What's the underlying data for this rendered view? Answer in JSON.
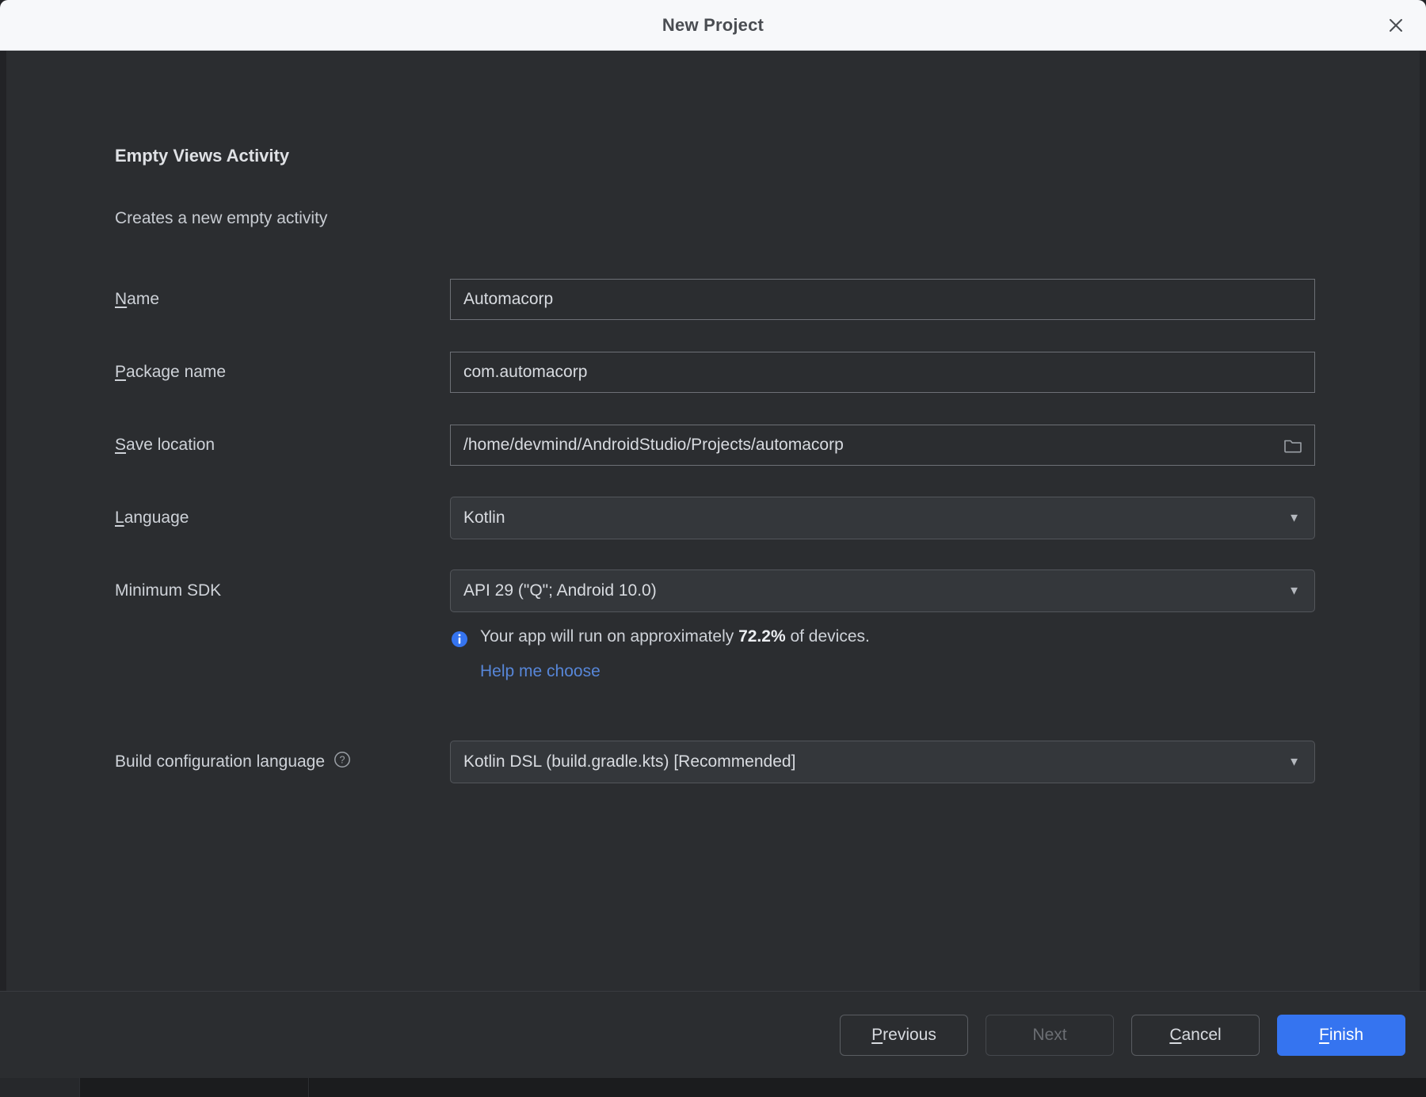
{
  "window": {
    "title": "New Project",
    "close_icon": "close-icon"
  },
  "step": {
    "title": "Empty Views Activity",
    "subtitle": "Creates a new empty activity"
  },
  "form": {
    "name": {
      "label_mnemonic": "N",
      "label_rest": "ame",
      "value": "Automacorp"
    },
    "package_name": {
      "label_mnemonic": "P",
      "label_rest": "ackage name",
      "value": "com.automacorp"
    },
    "save_location": {
      "label_mnemonic": "S",
      "label_rest": "ave location",
      "value": "/home/devmind/AndroidStudio/Projects/automacorp",
      "browse_icon": "folder-icon"
    },
    "language": {
      "label_mnemonic": "L",
      "label_rest": "anguage",
      "value": "Kotlin",
      "arrow": "▼"
    },
    "minimum_sdk": {
      "label": "Minimum SDK",
      "value": "API 29 (\"Q\"; Android 10.0)",
      "arrow": "▼"
    },
    "sdk_info": {
      "icon": "info-icon",
      "text_before": "Your app will run on approximately ",
      "percent": "72.2%",
      "text_after": " of devices.",
      "link": "Help me choose"
    },
    "build_config_language": {
      "label": "Build configuration language",
      "help_icon": "help-icon",
      "value": "Kotlin DSL (build.gradle.kts) [Recommended]",
      "arrow": "▼"
    }
  },
  "footer": {
    "previous": {
      "mnemonic": "P",
      "rest": "revious"
    },
    "next": {
      "label": "Next",
      "disabled": true
    },
    "cancel": {
      "mnemonic": "C",
      "rest": "ancel"
    },
    "finish": {
      "mnemonic": "F",
      "rest": "inish"
    }
  },
  "colors": {
    "accent_blue": "#3574F0",
    "link_blue": "#5786D8",
    "dialog_bg": "#2B2D30",
    "titlebar_bg": "#F7F8FA"
  }
}
